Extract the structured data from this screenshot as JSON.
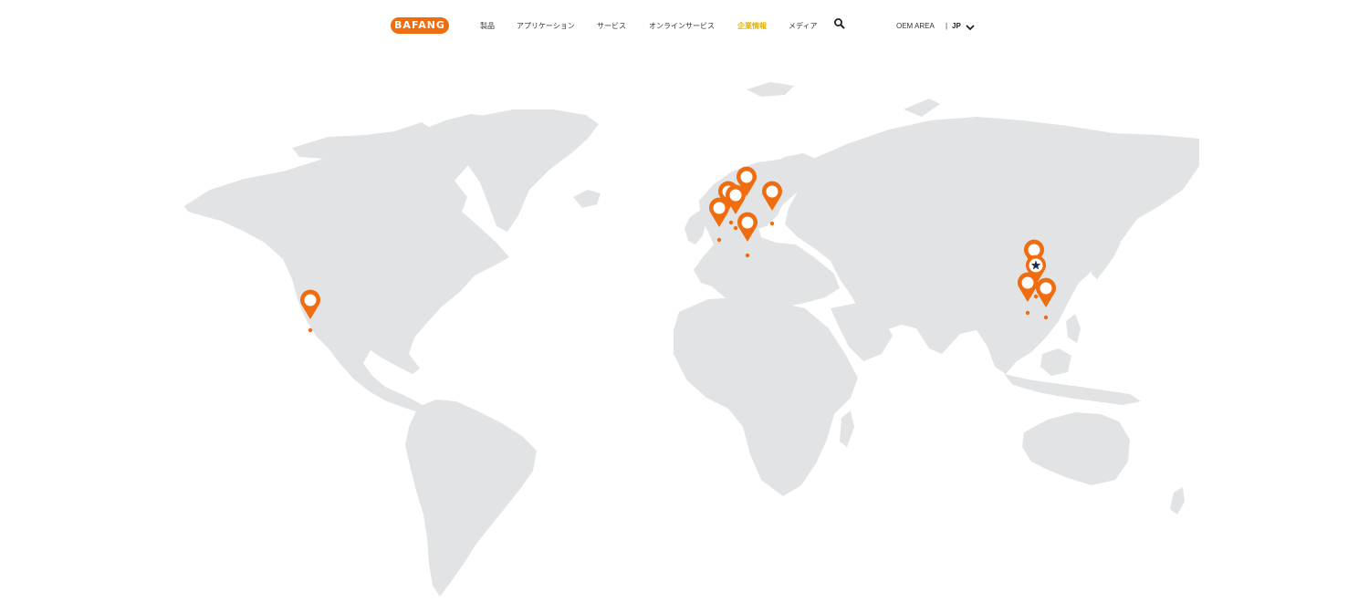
{
  "header": {
    "logo_text": "BAFANG",
    "menu": [
      {
        "label": "製品",
        "active": false
      },
      {
        "label": "アプリケーション",
        "active": false
      },
      {
        "label": "サービス",
        "active": false
      },
      {
        "label": "オンラインサービス",
        "active": false
      },
      {
        "label": "企業情報",
        "active": true
      },
      {
        "label": "メディア",
        "active": false
      }
    ],
    "search_icon": "search-icon",
    "oem_area": "OEM AREA",
    "separator": "|",
    "language": "JP",
    "language_dropdown_icon": "chevron-down-icon"
  },
  "map": {
    "land_color": "#e1e3e4",
    "pin_color": "#ef6c0f",
    "hq_star_color": "#1c2b4a",
    "locations": [
      {
        "name": "us-west"
      },
      {
        "name": "europe-netherlands"
      },
      {
        "name": "europe-germany-north"
      },
      {
        "name": "europe-germany"
      },
      {
        "name": "europe-denmark"
      },
      {
        "name": "europe-poland"
      },
      {
        "name": "europe-germany-south"
      },
      {
        "name": "china-north"
      },
      {
        "name": "china-hq"
      },
      {
        "name": "china-suzhou"
      },
      {
        "name": "china-south"
      }
    ]
  }
}
